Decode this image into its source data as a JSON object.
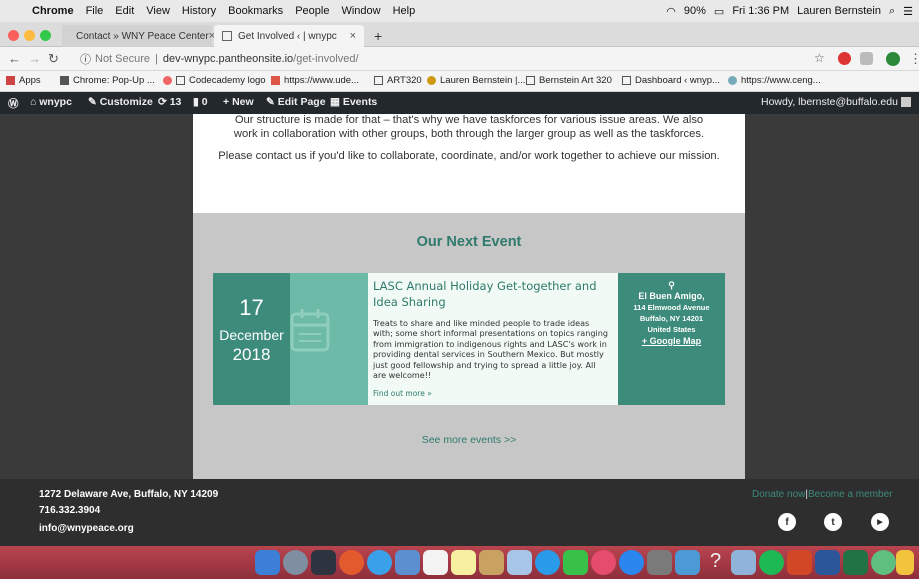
{
  "menubar": {
    "app": "Chrome",
    "items": [
      "File",
      "Edit",
      "View",
      "History",
      "Bookmarks",
      "People",
      "Window",
      "Help"
    ],
    "battery": "90%",
    "clock": "Fri 1:36 PM",
    "user": "Lauren Bernstein"
  },
  "tabs": [
    {
      "label": "Contact » WNY Peace Center",
      "close": "×"
    },
    {
      "label": "Get Involved ‹ | wnypc",
      "close": "×"
    }
  ],
  "new_tab": "+",
  "address": {
    "security": "Not Secure",
    "host": "dev-wnypc.pantheonsite.io",
    "path": "/get-involved/"
  },
  "bookmarks": [
    "Apps",
    "Chrome: Pop-Up ...",
    "Codecademy logo",
    "https://www.ude...",
    "ART320",
    "Lauren Bernstein |...",
    "Bernstein Art 320",
    "Dashboard ‹ wnyp...",
    "https://www.ceng..."
  ],
  "wpbar": {
    "site": "wnypc",
    "customize": "Customize",
    "updates": "13",
    "comments": "0",
    "new": "New",
    "edit": "Edit Page",
    "events": "Events",
    "howdy": "Howdy, lbernste@buffalo.edu"
  },
  "content": {
    "para1": "Our structure is made for that – that's why we have taskforces for various issue areas. We also work in collaboration with other groups, both through the larger group as well as the taskforces.",
    "para2": "Please contact us if you'd like to collaborate, coordinate, and/or work together to achieve our mission.",
    "event_heading": "Our Next Event",
    "event": {
      "day": "17",
      "month": "December",
      "year": "2018",
      "title": "LASC Annual Holiday Get-together and Idea Sharing",
      "description": "Treats to share and like minded people to trade ideas with; some short informal presentations on topics ranging from immigration to indigenous rights and LASC's work in providing  dental services in Southern Mexico. But mostly just good fellowship and trying to spread a little joy. All are welcome!!",
      "find_out_more": "Find out more »",
      "venue": "El Buen Amigo,",
      "street": "114 Elmwood Avenue",
      "city": "Buffalo, NY 14201",
      "country": "United States",
      "map_link": "+ Google Map"
    },
    "see_more": "See more events >>"
  },
  "footer": {
    "address": "1272 Delaware Ave, Buffalo, NY 14209",
    "phone": "716.332.3904",
    "email": "info@wnypeace.org",
    "donate": "Donate now",
    "separator": "|",
    "member": "Become a member"
  },
  "colors": {
    "accent": "#3d8b7b",
    "accent_light": "#6dbaa8",
    "heading": "#2f7a6c",
    "footer_link": "#3d8b7b"
  }
}
